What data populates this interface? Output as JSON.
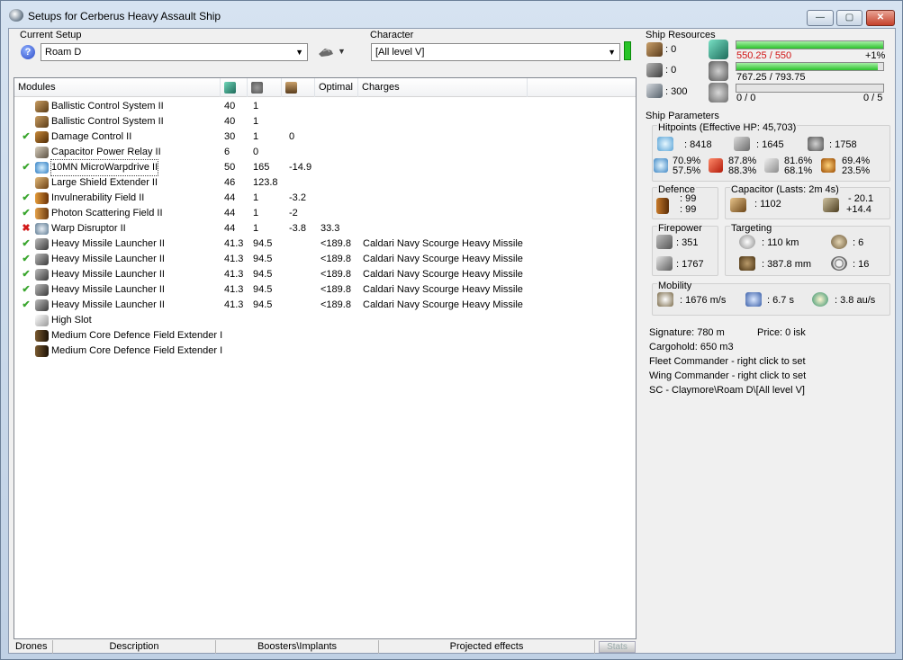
{
  "window": {
    "title": "Setups for Cerberus Heavy Assault Ship",
    "minimize_glyph": "—",
    "maximize_glyph": "▢",
    "close_glyph": "✕"
  },
  "setup": {
    "current_setup_label": "Current Setup",
    "current_setup_value": "Roam D",
    "character_label": "Character",
    "character_value": "[All level V]"
  },
  "modules": {
    "headers": {
      "name": "Modules",
      "optimal": "Optimal",
      "charges": "Charges"
    },
    "rows": [
      {
        "status": "",
        "name": "Ballistic Control System II",
        "cpu": "40",
        "pg": "1",
        "cap": "",
        "optimal": "",
        "charges": "",
        "icon": "ballistic-control-icon"
      },
      {
        "status": "",
        "name": "Ballistic Control System II",
        "cpu": "40",
        "pg": "1",
        "cap": "",
        "optimal": "",
        "charges": "",
        "icon": "ballistic-control-icon"
      },
      {
        "status": "✔",
        "name": "Damage Control II",
        "cpu": "30",
        "pg": "1",
        "cap": "0",
        "optimal": "",
        "charges": "",
        "icon": "damage-control-icon"
      },
      {
        "status": "",
        "name": "Capacitor Power Relay II",
        "cpu": "6",
        "pg": "0",
        "cap": "",
        "optimal": "",
        "charges": "",
        "icon": "capacitor-relay-icon"
      },
      {
        "status": "✔",
        "name": "10MN MicroWarpdrive II",
        "cpu": "50",
        "pg": "165",
        "cap": "-14.9",
        "optimal": "",
        "charges": "",
        "icon": "microwarpdrive-icon"
      },
      {
        "status": "",
        "name": "Large Shield Extender II",
        "cpu": "46",
        "pg": "123.8",
        "cap": "",
        "optimal": "",
        "charges": "",
        "icon": "shield-extender-icon"
      },
      {
        "status": "✔",
        "name": "Invulnerability Field II",
        "cpu": "44",
        "pg": "1",
        "cap": "-3.2",
        "optimal": "",
        "charges": "",
        "icon": "invulnerability-field-icon"
      },
      {
        "status": "✔",
        "name": "Photon Scattering Field II",
        "cpu": "44",
        "pg": "1",
        "cap": "-2",
        "optimal": "",
        "charges": "",
        "icon": "photon-scattering-icon"
      },
      {
        "status": "✖",
        "name": "Warp Disruptor II",
        "cpu": "44",
        "pg": "1",
        "cap": "-3.8",
        "optimal": "33.3",
        "charges": "",
        "icon": "warp-disruptor-icon"
      },
      {
        "status": "✔",
        "name": "Heavy Missile Launcher II",
        "cpu": "41.3",
        "pg": "94.5",
        "cap": "",
        "optimal": "<189.8",
        "charges": "Caldari Navy Scourge Heavy Missile",
        "icon": "missile-launcher-icon"
      },
      {
        "status": "✔",
        "name": "Heavy Missile Launcher II",
        "cpu": "41.3",
        "pg": "94.5",
        "cap": "",
        "optimal": "<189.8",
        "charges": "Caldari Navy Scourge Heavy Missile",
        "icon": "missile-launcher-icon"
      },
      {
        "status": "✔",
        "name": "Heavy Missile Launcher II",
        "cpu": "41.3",
        "pg": "94.5",
        "cap": "",
        "optimal": "<189.8",
        "charges": "Caldari Navy Scourge Heavy Missile",
        "icon": "missile-launcher-icon"
      },
      {
        "status": "✔",
        "name": "Heavy Missile Launcher II",
        "cpu": "41.3",
        "pg": "94.5",
        "cap": "",
        "optimal": "<189.8",
        "charges": "Caldari Navy Scourge Heavy Missile",
        "icon": "missile-launcher-icon"
      },
      {
        "status": "✔",
        "name": "Heavy Missile Launcher II",
        "cpu": "41.3",
        "pg": "94.5",
        "cap": "",
        "optimal": "<189.8",
        "charges": "Caldari Navy Scourge Heavy Missile",
        "icon": "missile-launcher-icon"
      },
      {
        "status": "",
        "name": "High Slot",
        "cpu": "",
        "pg": "",
        "cap": "",
        "optimal": "",
        "charges": "",
        "icon": "high-slot-icon"
      },
      {
        "status": "",
        "name": "Medium Core Defence Field Extender I",
        "cpu": "",
        "pg": "",
        "cap": "",
        "optimal": "",
        "charges": "",
        "icon": "rig-icon"
      },
      {
        "status": "",
        "name": "Medium Core Defence Field Extender I",
        "cpu": "",
        "pg": "",
        "cap": "",
        "optimal": "",
        "charges": "",
        "icon": "rig-icon"
      }
    ]
  },
  "bottom_tabs": {
    "drones": "Drones",
    "description": "Description",
    "boosters": "Boosters\\Implants",
    "projected": "Projected effects",
    "stats": "Stats"
  },
  "resources": {
    "title": "Ship Resources",
    "turret_slots": ": 0",
    "launcher_slots": ": 0",
    "drone_bay": ": 300",
    "cpu": "550.25 / 550",
    "cpu_pct": "+1%",
    "cpu_fill": 1.0,
    "pg": "767.25 / 793.75",
    "pg_fill": 0.966,
    "calib": "0 / 0",
    "calib_right": "0 / 5",
    "calib_fill": 0.0
  },
  "params": {
    "title": "Ship Parameters",
    "hitpoints_label": "Hitpoints (Effective HP: 45,703)",
    "shield_hp": ": 8418",
    "armor_hp": ": 1645",
    "structure_hp": ": 1758",
    "res_em_top": "70.9%",
    "res_em_bottom": "57.5%",
    "res_th_top": "87.8%",
    "res_th_bottom": "88.3%",
    "res_ki_top": "81.6%",
    "res_ki_bottom": "68.1%",
    "res_ex_top": "69.4%",
    "res_ex_bottom": "23.5%",
    "defence_label": "Defence",
    "defence_top": ": 99",
    "defence_bottom": ": 99",
    "capacitor_label": "Capacitor (Lasts: 2m 4s)",
    "capacitor_value": ": 1102",
    "cap_delta_top": "- 20.1",
    "cap_delta_bottom": "+14.4",
    "firepower_label": "Firepower",
    "firepower_top": ": 351",
    "firepower_bottom": ": 1767",
    "targeting_label": "Targeting",
    "target_range": ": 110 km",
    "scan_res": ": 387.8 mm",
    "max_targets": ": 6",
    "sensor_strength": ": 16",
    "mobility_label": "Mobility",
    "speed": ": 1676 m/s",
    "align": ": 6.7 s",
    "warp": ": 3.8 au/s"
  },
  "info": {
    "signature": "Signature: 780 m",
    "price": "Price: 0 isk",
    "cargohold": "Cargohold: 650 m3",
    "fleet_commander": "Fleet Commander - right click to set",
    "wing_commander": "Wing Commander - right click to set",
    "path": "SC - Claymore\\Roam D\\[All level V]"
  }
}
